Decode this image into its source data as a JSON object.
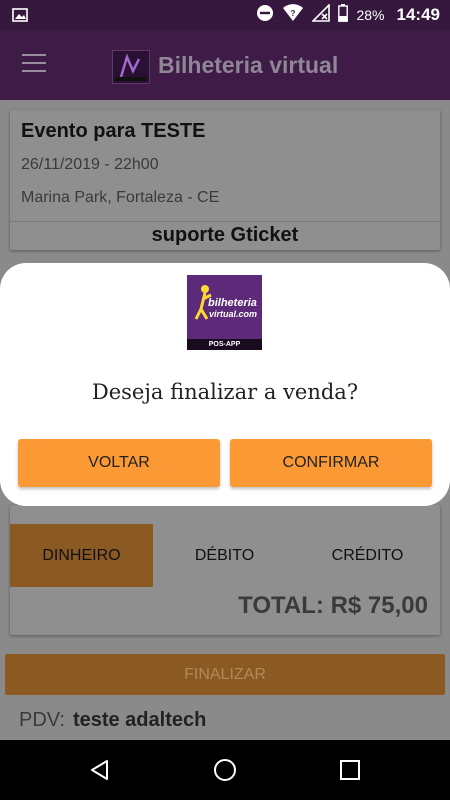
{
  "status_bar": {
    "battery_percent": "28%",
    "time": "14:49",
    "icons": [
      "image-icon",
      "do-not-disturb-icon",
      "wifi-icon",
      "no-signal-icon",
      "battery-icon"
    ]
  },
  "app_bar": {
    "title": "Bilheteria virtual",
    "icons": [
      "menu-icon",
      "app-logo"
    ]
  },
  "event": {
    "title": "Evento para TESTE",
    "date": "26/11/2019 - 22h00",
    "location": "Marina Park, Fortaleza - CE",
    "support": "suporte Gticket"
  },
  "payment": {
    "methods": [
      "DINHEIRO",
      "DÉBITO",
      "CRÉDITO"
    ],
    "selected": "DINHEIRO",
    "total": "TOTAL: R$ 75,00"
  },
  "finalize_label": "FINALIZAR",
  "pdv": {
    "label": "PDV:",
    "value": "teste adaltech"
  },
  "dialog": {
    "logo_line1": "bilheteria",
    "logo_line2": "virtual.com",
    "logo_strip": "POS-APP",
    "message": "Deseja finalizar a venda?",
    "cancel_label": "VOLTAR",
    "confirm_label": "CONFIRMAR"
  },
  "colors": {
    "app_bar": "#3f1b48",
    "accent_orange": "#fb9a35",
    "dimmed_background": "#8a8a8a"
  },
  "nav_bar": {
    "icons": [
      "back-icon",
      "home-icon",
      "recent-apps-icon"
    ]
  }
}
